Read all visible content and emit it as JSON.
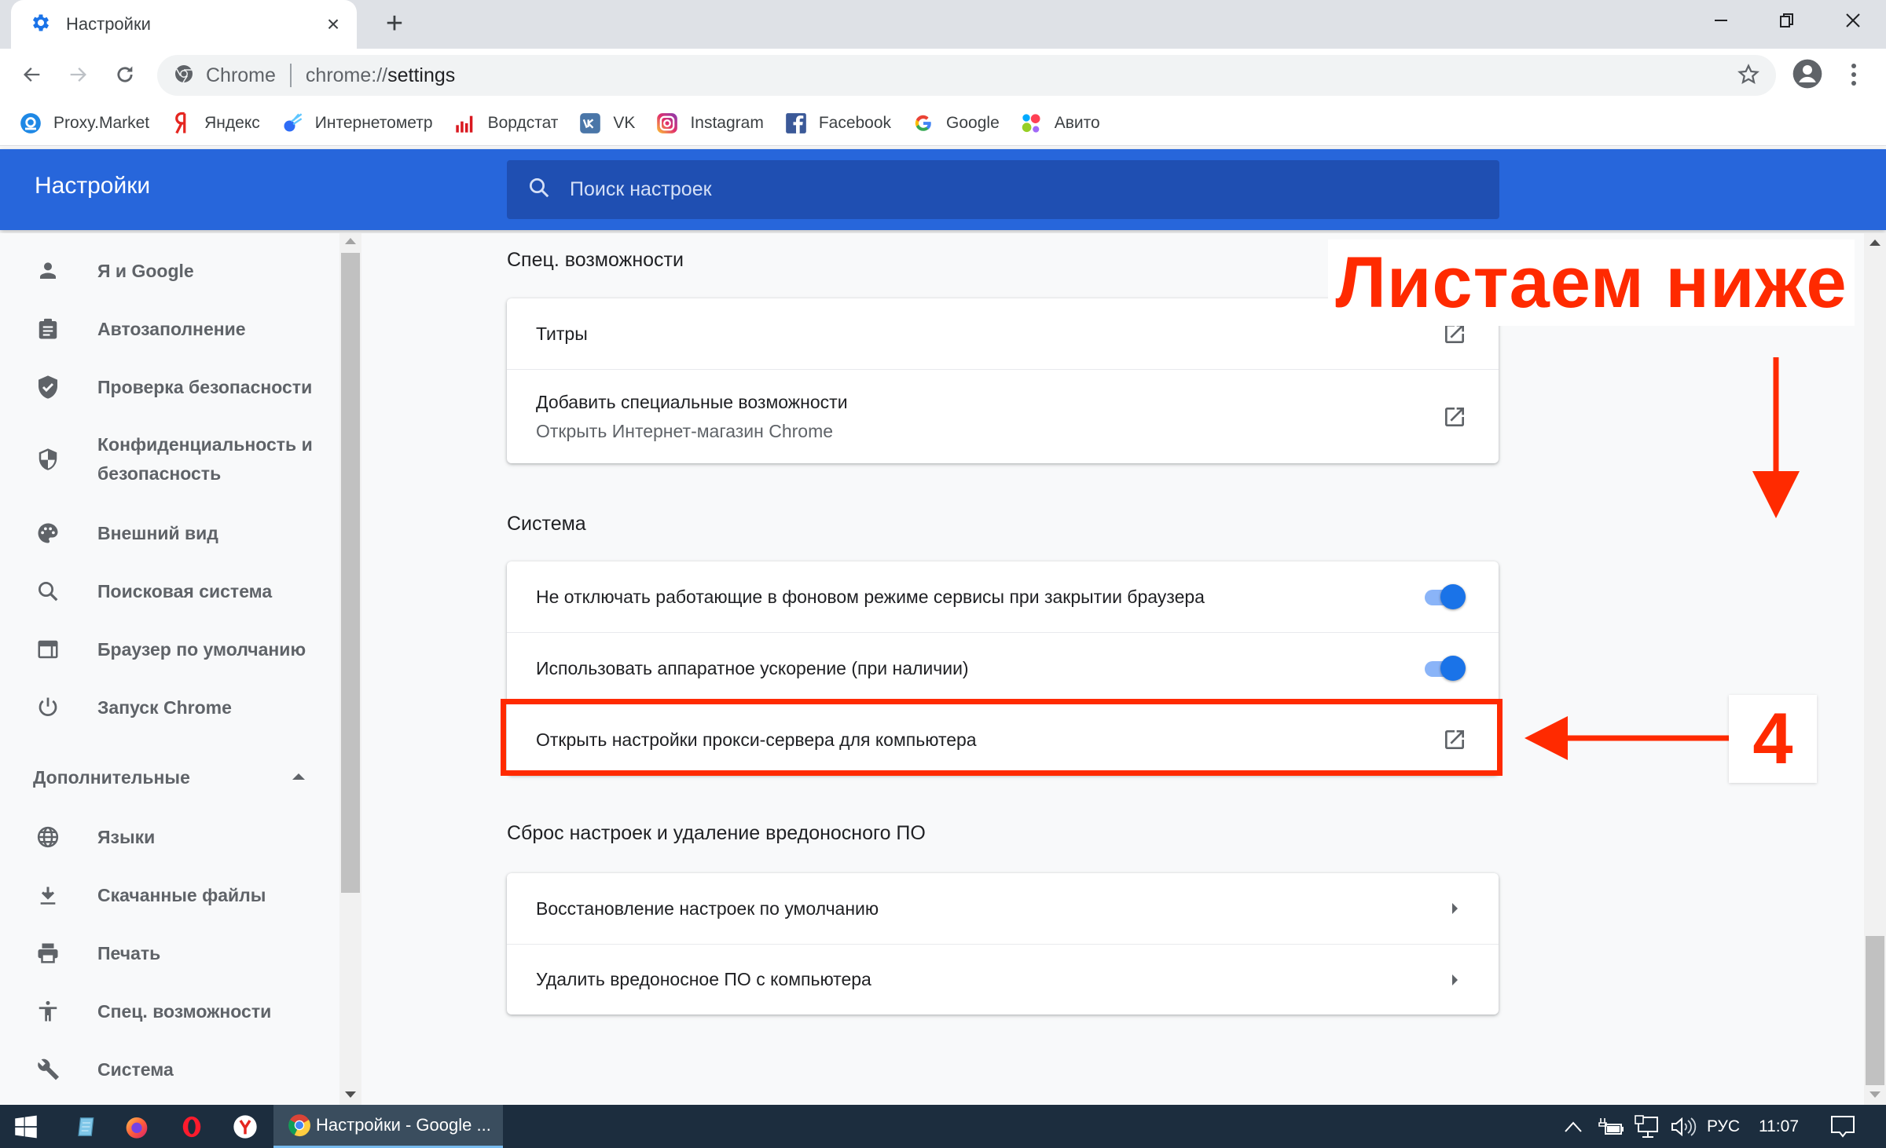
{
  "browser": {
    "tab": {
      "title": "Настройки",
      "icon": "gear-icon",
      "close_label": "×"
    },
    "new_tab_label": "+",
    "window_controls": {
      "minimize": "–",
      "maximize": "❐",
      "close": "X"
    },
    "omnibox": {
      "origin_chip": "Chrome",
      "url_scheme": "chrome://",
      "url_path": "settings"
    },
    "bookmarks": [
      {
        "label": "Proxy.Market",
        "icon": "proxy-market-icon",
        "color": "#1e88e5"
      },
      {
        "label": "Яндекс",
        "icon": "yandex-icon",
        "color": "#e52620"
      },
      {
        "label": "Интернетометр",
        "icon": "internetometr-icon",
        "color": "#2e6cf6"
      },
      {
        "label": "Вордстат",
        "icon": "wordstat-icon",
        "color": "#d9181f"
      },
      {
        "label": "VK",
        "icon": "vk-icon",
        "color": "#4a76a8"
      },
      {
        "label": "Instagram",
        "icon": "instagram-icon",
        "color": "#d6249f"
      },
      {
        "label": "Facebook",
        "icon": "facebook-icon",
        "color": "#3b5998"
      },
      {
        "label": "Google",
        "icon": "google-icon",
        "color": "#4285f4"
      },
      {
        "label": "Авито",
        "icon": "avito-icon",
        "color": "#00aaff"
      }
    ]
  },
  "settings": {
    "header_title": "Настройки",
    "search": {
      "placeholder": "Поиск настроек"
    },
    "sidebar": {
      "items": [
        {
          "label": "Я и Google",
          "icon": "person-icon"
        },
        {
          "label": "Автозаполнение",
          "icon": "clipboard-icon"
        },
        {
          "label": "Проверка безопасности",
          "icon": "shield-check-icon"
        },
        {
          "label": "Конфиденциальность и безопасность",
          "icon": "shield-half-icon"
        },
        {
          "label": "Внешний вид",
          "icon": "palette-icon"
        },
        {
          "label": "Поисковая система",
          "icon": "search-icon"
        },
        {
          "label": "Браузер по умолчанию",
          "icon": "browser-window-icon"
        },
        {
          "label": "Запуск Chrome",
          "icon": "power-icon"
        }
      ],
      "advanced_label": "Дополнительные",
      "advanced_items": [
        {
          "label": "Языки",
          "icon": "globe-icon"
        },
        {
          "label": "Скачанные файлы",
          "icon": "download-icon"
        },
        {
          "label": "Печать",
          "icon": "printer-icon"
        },
        {
          "label": "Спец. возможности",
          "icon": "accessibility-icon"
        },
        {
          "label": "Система",
          "icon": "wrench-icon"
        }
      ]
    },
    "sections": [
      {
        "title": "Спец. возможности",
        "rows": [
          {
            "label": "Титры",
            "control": "external-link"
          },
          {
            "label": "Добавить специальные возможности",
            "sublabel": "Открыть Интернет-магазин Chrome",
            "control": "external-link"
          }
        ]
      },
      {
        "title": "Система",
        "rows": [
          {
            "label": "Не отключать работающие в фоновом режиме сервисы при закрытии браузера",
            "control": "toggle",
            "checked": true
          },
          {
            "label": "Использовать аппаратное ускорение (при наличии)",
            "control": "toggle",
            "checked": true
          },
          {
            "label": "Открыть настройки прокси-сервера для компьютера",
            "control": "external-link",
            "highlighted": true
          }
        ]
      },
      {
        "title": "Сброс настроек и удаление вредоносного ПО",
        "rows": [
          {
            "label": "Восстановление настроек по умолчанию",
            "control": "chevron"
          },
          {
            "label": "Удалить вредоносное ПО с компьютера",
            "control": "chevron"
          }
        ]
      }
    ]
  },
  "annotations": {
    "banner_text": "Листаем ниже",
    "step_number": "4",
    "accent_color": "#ff2a00"
  },
  "taskbar": {
    "pinned": [
      {
        "name": "windows-start",
        "icon": "windows-logo-icon"
      },
      {
        "name": "notepad",
        "icon": "notepad-icon"
      },
      {
        "name": "firefox",
        "icon": "firefox-icon"
      },
      {
        "name": "opera",
        "icon": "opera-icon"
      },
      {
        "name": "yandex-browser",
        "icon": "yandex-browser-icon"
      }
    ],
    "active_app_title": "Настройки - Google ...",
    "language": "РУС",
    "clock": "11:07"
  }
}
